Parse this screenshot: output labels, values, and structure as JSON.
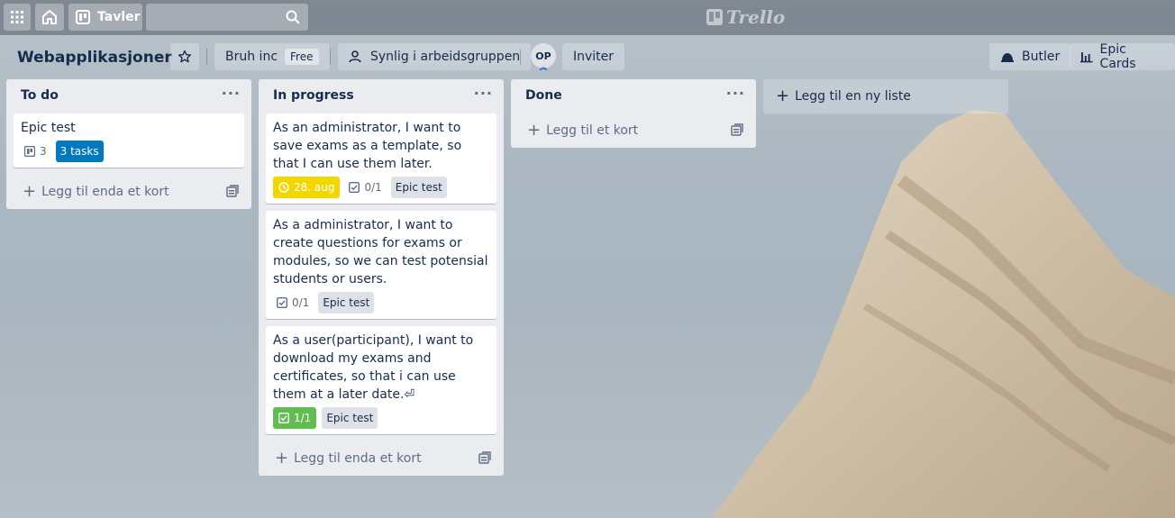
{
  "topbar": {
    "boards_label": "Tavler",
    "search_placeholder": "",
    "logo_text": "Trello"
  },
  "board": {
    "title": "Webapplikasjoner",
    "workspace": "Bruh inc",
    "plan_badge": "Free",
    "visibility": "Synlig i arbeidsgruppen",
    "member_initials": "OP",
    "invite_label": "Inviter",
    "butler_label": "Butler",
    "epic_cards_label": "Epic Cards"
  },
  "lists": [
    {
      "title": "To do",
      "cards": [
        {
          "title": "Epic test",
          "board_count": "3",
          "tasks_badge": "3 tasks"
        }
      ],
      "add_card_label": "Legg til enda et kort"
    },
    {
      "title": "In progress",
      "cards": [
        {
          "title": "As an administrator, I want to save exams as a template, so that I can use them later.",
          "due": "28. aug",
          "checklist": "0/1",
          "label": "Epic test"
        },
        {
          "title": "As a administrator, I want to create questions for exams or modules, so we can test potensial students or users.",
          "checklist": "0/1",
          "label": "Epic test"
        },
        {
          "title": "As a user(participant), I want to download my exams and certificates, so that i can use them at a later date.⏎",
          "checklist": "1/1",
          "label": "Epic test"
        }
      ],
      "add_card_label": "Legg til enda et kort"
    },
    {
      "title": "Done",
      "cards": [],
      "add_card_label": "Legg til et kort"
    }
  ],
  "new_list_label": "Legg til en ny liste",
  "colors": {
    "due_badge": "#f2d600",
    "complete_badge": "#61bd4f",
    "tasks_badge": "#0079bf",
    "list_bg": "#ebecf0"
  }
}
